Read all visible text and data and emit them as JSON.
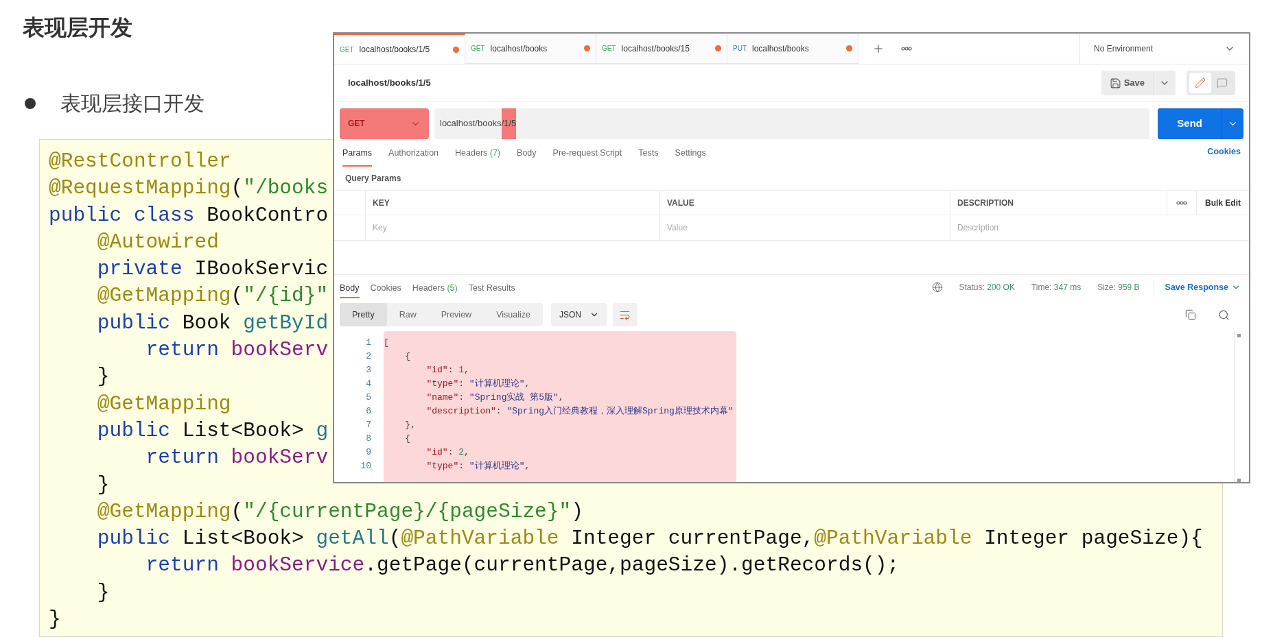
{
  "slide": {
    "title": "表现层开发",
    "bullet": "表现层接口开发",
    "code_lines": [
      [
        {
          "kind": "annotation",
          "text": "@RestController"
        }
      ],
      [
        {
          "kind": "annotation",
          "text": "@RequestMapping"
        },
        {
          "kind": "plain",
          "text": "("
        },
        {
          "kind": "string",
          "text": "\"/books"
        }
      ],
      [
        {
          "kind": "keyword",
          "text": "public class"
        },
        {
          "kind": "plain",
          "text": " BookContro"
        }
      ],
      [
        {
          "kind": "annotation",
          "text": "    @Autowired"
        }
      ],
      [
        {
          "kind": "keyword",
          "text": "    private"
        },
        {
          "kind": "plain",
          "text": " IBookServic"
        }
      ],
      [
        {
          "kind": "annotation",
          "text": "    @GetMapping"
        },
        {
          "kind": "plain",
          "text": "("
        },
        {
          "kind": "string",
          "text": "\"/{id}\""
        }
      ],
      [
        {
          "kind": "keyword",
          "text": "    public"
        },
        {
          "kind": "plain",
          "text": " Book "
        },
        {
          "kind": "method",
          "text": "getById"
        }
      ],
      [
        {
          "kind": "keyword",
          "text": "        return"
        },
        {
          "kind": "field",
          "text": " bookServ"
        }
      ],
      [
        {
          "kind": "plain",
          "text": "    }"
        }
      ],
      [
        {
          "kind": "annotation",
          "text": "    @GetMapping"
        }
      ],
      [
        {
          "kind": "keyword",
          "text": "    public"
        },
        {
          "kind": "plain",
          "text": " List<Book> "
        },
        {
          "kind": "method",
          "text": "g"
        }
      ],
      [
        {
          "kind": "keyword",
          "text": "        return"
        },
        {
          "kind": "field",
          "text": " bookServ"
        }
      ],
      [
        {
          "kind": "plain",
          "text": "    }"
        }
      ],
      [
        {
          "kind": "annotation",
          "text": "    @GetMapping"
        },
        {
          "kind": "plain",
          "text": "("
        },
        {
          "kind": "string",
          "text": "\"/{currentPage}/{pageSize}\""
        },
        {
          "kind": "plain",
          "text": ")"
        }
      ],
      [
        {
          "kind": "keyword",
          "text": "    public"
        },
        {
          "kind": "plain",
          "text": " List<Book> "
        },
        {
          "kind": "method",
          "text": "getAll"
        },
        {
          "kind": "plain",
          "text": "("
        },
        {
          "kind": "annotation",
          "text": "@PathVariable"
        },
        {
          "kind": "plain",
          "text": " Integer currentPage,"
        },
        {
          "kind": "annotation",
          "text": "@PathVariable"
        },
        {
          "kind": "plain",
          "text": " Integer pageSize){"
        }
      ],
      [
        {
          "kind": "keyword",
          "text": "        return"
        },
        {
          "kind": "field",
          "text": " bookService"
        },
        {
          "kind": "plain",
          "text": ".getPage(currentPage,pageSize).getRecords();"
        }
      ],
      [
        {
          "kind": "plain",
          "text": "    }"
        }
      ],
      [
        {
          "kind": "plain",
          "text": "}"
        }
      ]
    ]
  },
  "postman": {
    "tabs": [
      {
        "method": "GET",
        "color": "#3fae5b",
        "url": "localhost/books/1/5",
        "selected": true,
        "unsaved": true
      },
      {
        "method": "GET",
        "color": "#3fae5b",
        "url": "localhost/books",
        "selected": false,
        "unsaved": true
      },
      {
        "method": "GET",
        "color": "#3fae5b",
        "url": "localhost/books/15",
        "selected": false,
        "unsaved": true
      },
      {
        "method": "PUT",
        "color": "#3b7be0",
        "url": "localhost/books",
        "selected": false,
        "unsaved": true
      }
    ],
    "environment": "No Environment",
    "request_name": "localhost/books/1/5",
    "save_label": "Save",
    "method": {
      "text": "GET",
      "highlighted": true
    },
    "url_parts": [
      {
        "text": "localhost/books",
        "highlighted": false
      },
      {
        "text": "/1/5",
        "highlighted": true
      }
    ],
    "send_label": "Send",
    "request_tabs": [
      {
        "label": "Params",
        "selected": true
      },
      {
        "label": "Authorization",
        "selected": false
      },
      {
        "label": "Headers",
        "count": "(7)",
        "selected": false
      },
      {
        "label": "Body",
        "selected": false
      },
      {
        "label": "Pre-request Script",
        "selected": false
      },
      {
        "label": "Tests",
        "selected": false
      },
      {
        "label": "Settings",
        "selected": false
      }
    ],
    "cookies_link": "Cookies",
    "section_title": "Query Params",
    "params_columns": [
      "KEY",
      "VALUE",
      "DESCRIPTION"
    ],
    "bulk_edit": "Bulk Edit",
    "params_placeholders": [
      "Key",
      "Value",
      "Description"
    ],
    "response_tabs": [
      {
        "label": "Body",
        "selected": true
      },
      {
        "label": "Cookies",
        "selected": false
      },
      {
        "label": "Headers",
        "count": "(5)",
        "selected": false
      },
      {
        "label": "Test Results",
        "selected": false
      }
    ],
    "status": [
      {
        "label": "Status:",
        "value": "200 OK"
      },
      {
        "label": "Time:",
        "value": "347 ms"
      },
      {
        "label": "Size:",
        "value": "959 B"
      }
    ],
    "save_response": "Save Response",
    "views": [
      {
        "label": "Pretty",
        "selected": true
      },
      {
        "label": "Raw",
        "selected": false
      },
      {
        "label": "Preview",
        "selected": false
      },
      {
        "label": "Visualize",
        "selected": false
      }
    ],
    "format": "JSON",
    "body_highlighted": true,
    "body_lines": [
      {
        "number": "1",
        "tokens": [
          {
            "kind": "punct",
            "text": "["
          }
        ]
      },
      {
        "number": "2",
        "tokens": [
          {
            "kind": "punct",
            "text": "    {"
          }
        ]
      },
      {
        "number": "3",
        "tokens": [
          {
            "kind": "key",
            "text": "        \"id\""
          },
          {
            "kind": "punct",
            "text": ": "
          },
          {
            "kind": "number",
            "text": "1"
          },
          {
            "kind": "punct",
            "text": ","
          }
        ]
      },
      {
        "number": "4",
        "tokens": [
          {
            "kind": "key",
            "text": "        \"type\""
          },
          {
            "kind": "punct",
            "text": ": "
          },
          {
            "kind": "string",
            "text": "\"计算机理论\""
          },
          {
            "kind": "punct",
            "text": ","
          }
        ]
      },
      {
        "number": "5",
        "tokens": [
          {
            "kind": "key",
            "text": "        \"name\""
          },
          {
            "kind": "punct",
            "text": ": "
          },
          {
            "kind": "string",
            "text": "\"Spring实战 第5版\""
          },
          {
            "kind": "punct",
            "text": ","
          }
        ]
      },
      {
        "number": "6",
        "tokens": [
          {
            "kind": "key",
            "text": "        \"description\""
          },
          {
            "kind": "punct",
            "text": ": "
          },
          {
            "kind": "string",
            "text": "\"Spring入门经典教程，深入理解Spring原理技术内幕\""
          }
        ]
      },
      {
        "number": "7",
        "tokens": [
          {
            "kind": "punct",
            "text": "    },"
          }
        ]
      },
      {
        "number": "8",
        "tokens": [
          {
            "kind": "punct",
            "text": "    {"
          }
        ]
      },
      {
        "number": "9",
        "tokens": [
          {
            "kind": "key",
            "text": "        \"id\""
          },
          {
            "kind": "punct",
            "text": ": "
          },
          {
            "kind": "number",
            "text": "2"
          },
          {
            "kind": "punct",
            "text": ","
          }
        ]
      },
      {
        "number": "10",
        "tokens": [
          {
            "kind": "key",
            "text": "        \"type\""
          },
          {
            "kind": "punct",
            "text": ": "
          },
          {
            "kind": "string",
            "text": "\"计算机理论\""
          },
          {
            "kind": "punct",
            "text": ","
          }
        ]
      }
    ]
  }
}
